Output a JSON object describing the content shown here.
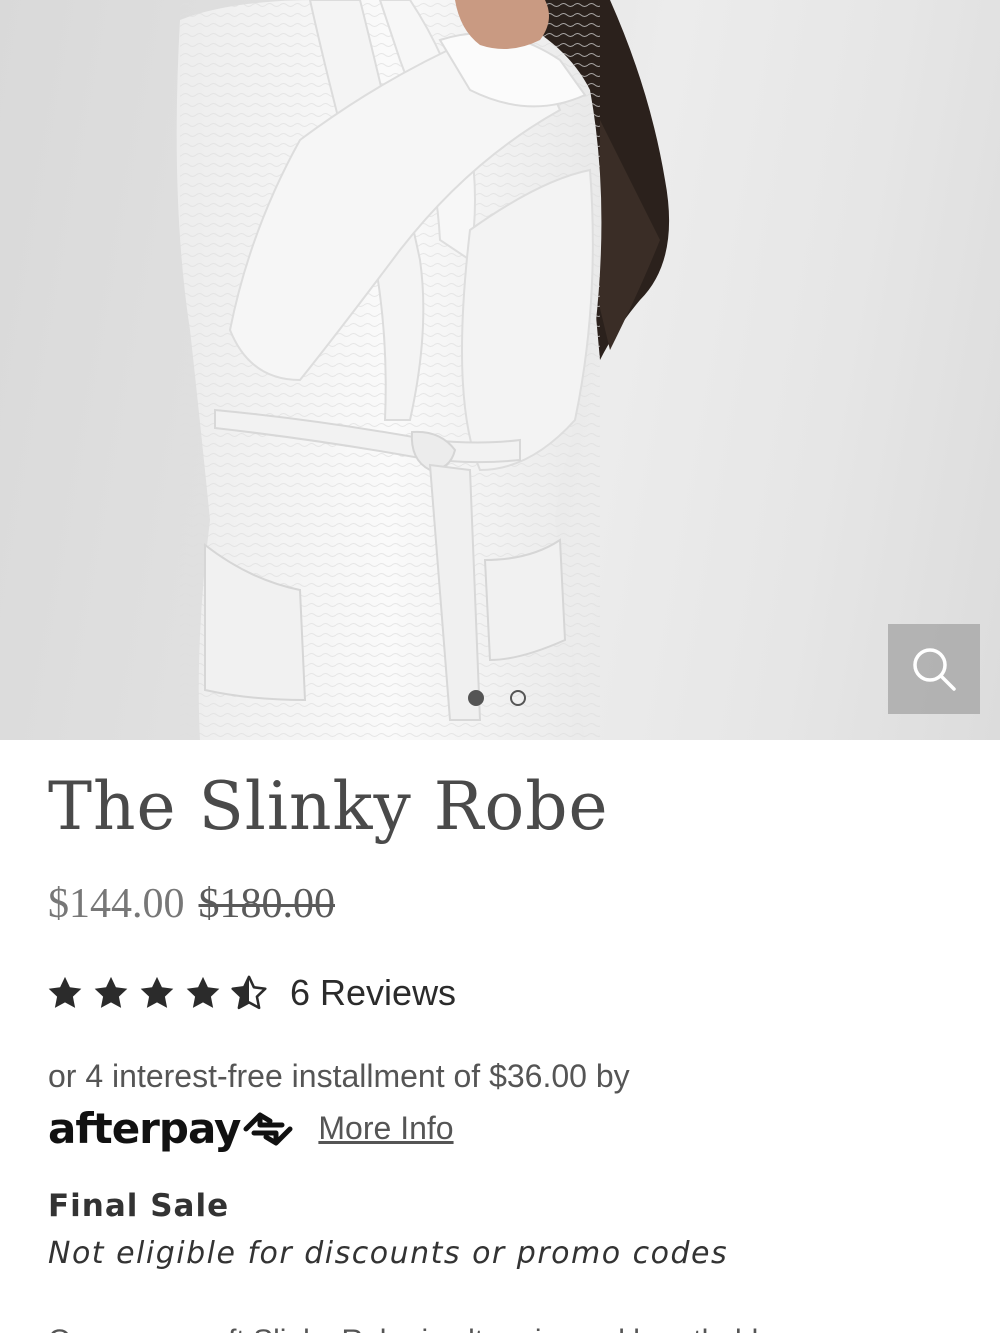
{
  "product": {
    "title": "The Slinky Robe",
    "sale_price": "$144.00",
    "original_price": "$180.00",
    "rating": 4.5,
    "rating_max": 5,
    "reviews_label": "6 Reviews"
  },
  "gallery": {
    "image_alt": "Model wearing white textured robe",
    "slide_count": 2,
    "active_slide": 1,
    "zoom_icon": "search-icon"
  },
  "payment": {
    "installment_text": "or 4 interest-free installment of $36.00 by",
    "provider_name": "afterpay",
    "more_info_label": "More Info"
  },
  "notice": {
    "heading": "Final Sale",
    "detail": "Not eligible for discounts or promo codes"
  },
  "description_fragment": "Our gauzy-soft Slinky Robe is ultra airy and breathable",
  "colors": {
    "text_dark": "#2f2f2f",
    "text_muted": "#777777",
    "zoom_bg": "#aaaaaa"
  }
}
